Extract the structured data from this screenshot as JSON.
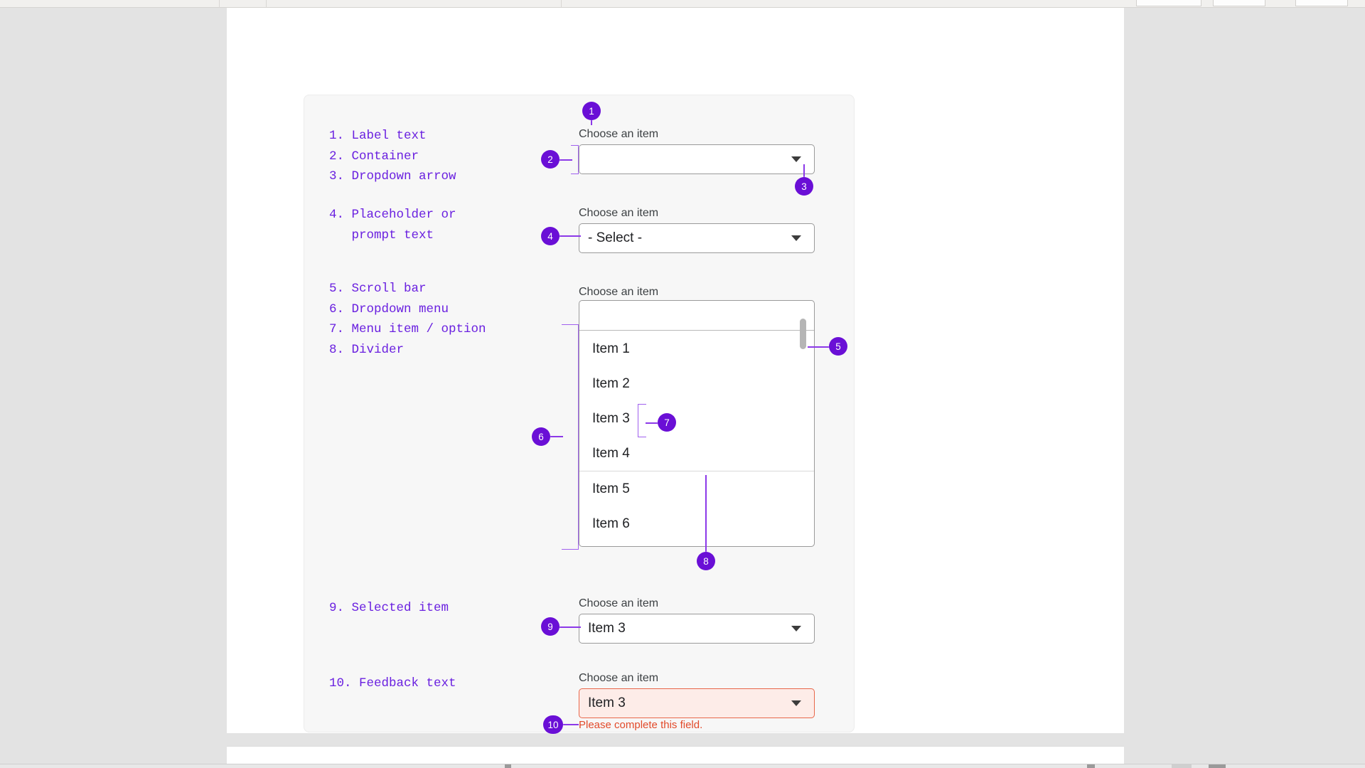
{
  "theme": {
    "accent_purple": "#6a0fd6",
    "lead_purple": "#8c39e8",
    "legend_purple": "#6a20e0",
    "error_red": "#e24a2a",
    "error_bg": "#fdece8",
    "card_bg": "#f7f7f7",
    "page_bg": "#ffffff"
  },
  "legend": {
    "group_a": "1. Label text\n2. Container\n3. Dropdown arrow",
    "group_b": "4. Placeholder or\n   prompt text",
    "group_c": "5. Scroll bar\n6. Dropdown menu\n7. Menu item / option\n8. Divider",
    "group_d": "9. Selected item",
    "group_e": "10. Feedback text",
    "items": [
      {
        "n": "1",
        "label": "Label text"
      },
      {
        "n": "2",
        "label": "Container"
      },
      {
        "n": "3",
        "label": "Dropdown arrow"
      },
      {
        "n": "4",
        "label": "Placeholder or prompt text"
      },
      {
        "n": "5",
        "label": "Scroll bar"
      },
      {
        "n": "6",
        "label": "Dropdown menu"
      },
      {
        "n": "7",
        "label": "Menu item / option"
      },
      {
        "n": "8",
        "label": "Divider"
      },
      {
        "n": "9",
        "label": "Selected item"
      },
      {
        "n": "10",
        "label": "Feedback text"
      }
    ]
  },
  "badges": {
    "b1": "1",
    "b2": "2",
    "b3": "3",
    "b4": "4",
    "b5": "5",
    "b6": "6",
    "b7": "7",
    "b8": "8",
    "b9": "9",
    "b10": "10"
  },
  "fields": {
    "empty": {
      "label": "Choose an item",
      "value": "",
      "placeholder": "",
      "caret": "chevron-down-icon"
    },
    "prompt": {
      "label": "Choose an item",
      "value": "- Select -",
      "placeholder": "- Select -",
      "caret": "chevron-down-icon"
    },
    "open": {
      "label": "Choose an item",
      "value": "",
      "caret": "chevron-up-icon",
      "options": [
        "Item 1",
        "Item 2",
        "Item 3",
        "Item 4",
        "Item 5",
        "Item 6"
      ],
      "divider_after_index": 3
    },
    "selected": {
      "label": "Choose an item",
      "value": "Item 3",
      "caret": "chevron-down-icon"
    },
    "invalid": {
      "label": "Choose an item",
      "value": "Item 3",
      "caret": "chevron-down-icon",
      "feedback": "Please complete this field."
    }
  }
}
